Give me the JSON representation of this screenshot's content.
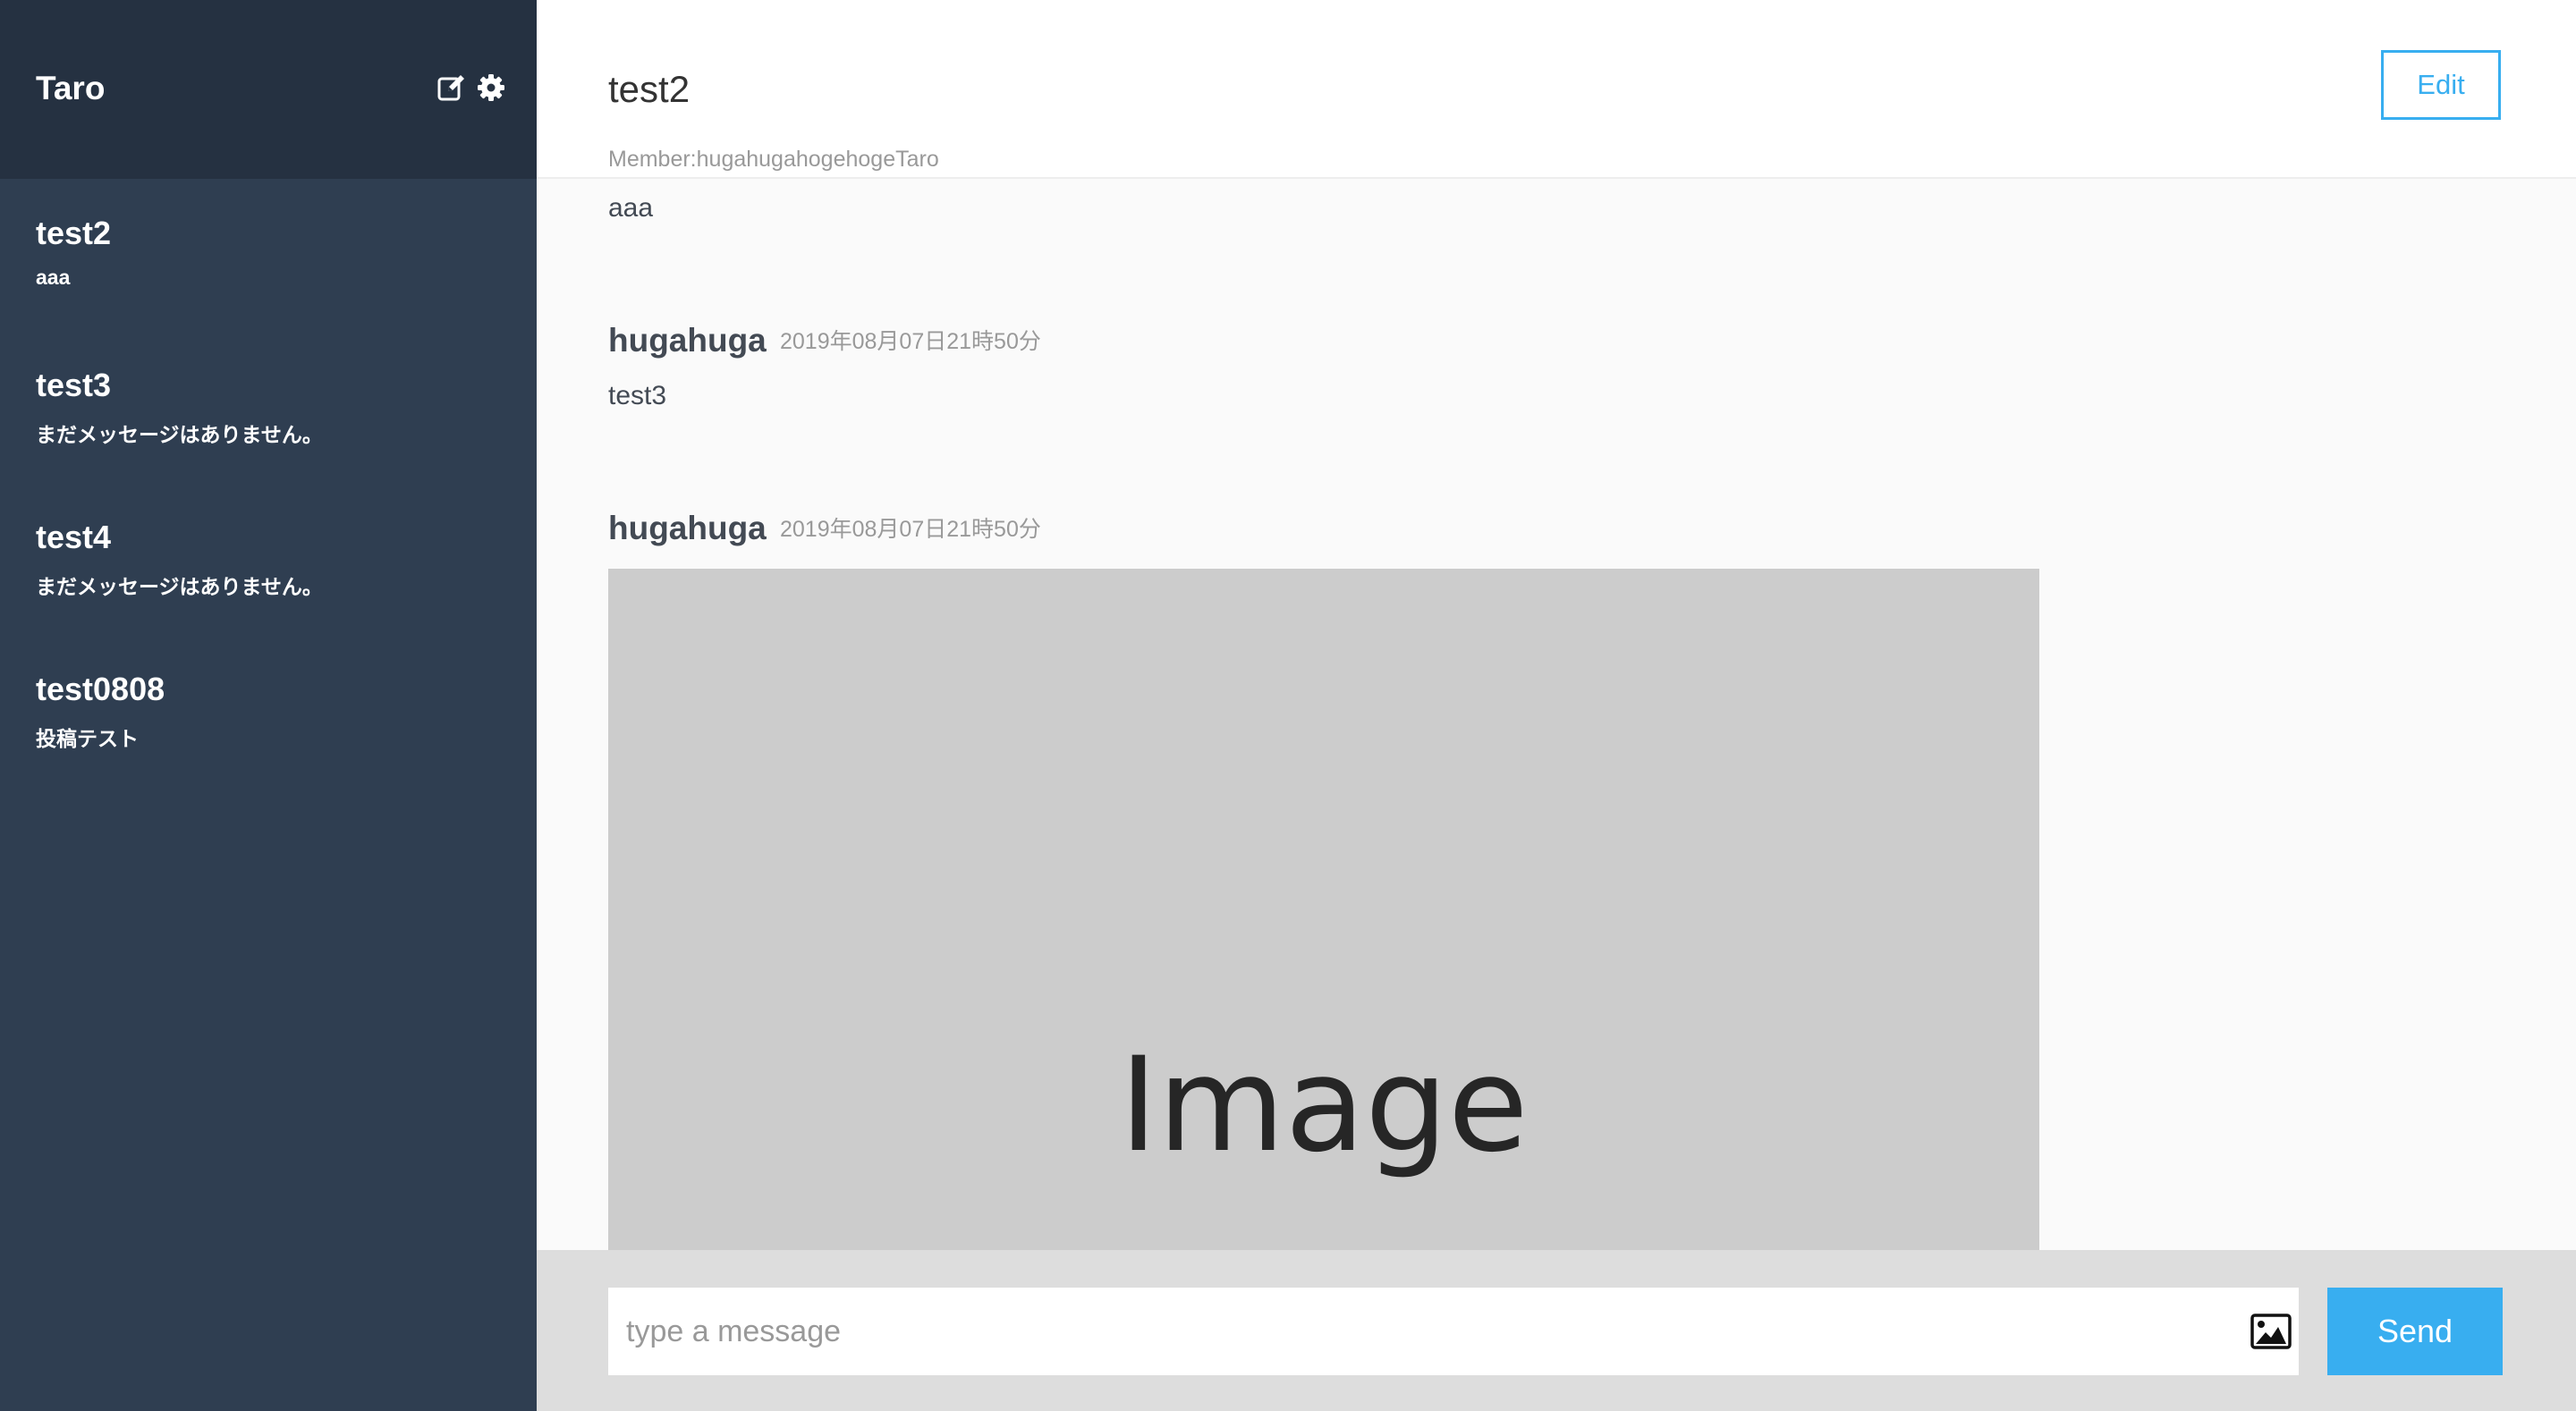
{
  "sidebar": {
    "user_name": "Taro",
    "icons": [
      "edit-icon",
      "gear-icon"
    ],
    "groups": [
      {
        "name": "test2",
        "last_message": "aaa"
      },
      {
        "name": "test3",
        "last_message": "まだメッセージはありません。"
      },
      {
        "name": "test4",
        "last_message": "まだメッセージはありません。"
      },
      {
        "name": "test0808",
        "last_message": "投稿テスト"
      }
    ]
  },
  "header": {
    "group_name": "test2",
    "members": "Member:hugahugahogehogeTaro",
    "edit_label": "Edit"
  },
  "messages": [
    {
      "text": "aaa"
    },
    {
      "user": "hugahuga",
      "date": "2019年08月07日21時50分",
      "text": "test3"
    },
    {
      "user": "hugahuga",
      "date": "2019年08月07日21時50分",
      "image_label": "Image"
    }
  ],
  "form": {
    "placeholder": "type a message",
    "image_icon": "image-icon",
    "send_label": "Send"
  },
  "colors": {
    "sidebar_bg": "#2f3e51",
    "sidebar_header_bg": "#253141",
    "accent": "#38aef0",
    "form_bg": "#dddddd",
    "image_placeholder": "#cccccc"
  }
}
